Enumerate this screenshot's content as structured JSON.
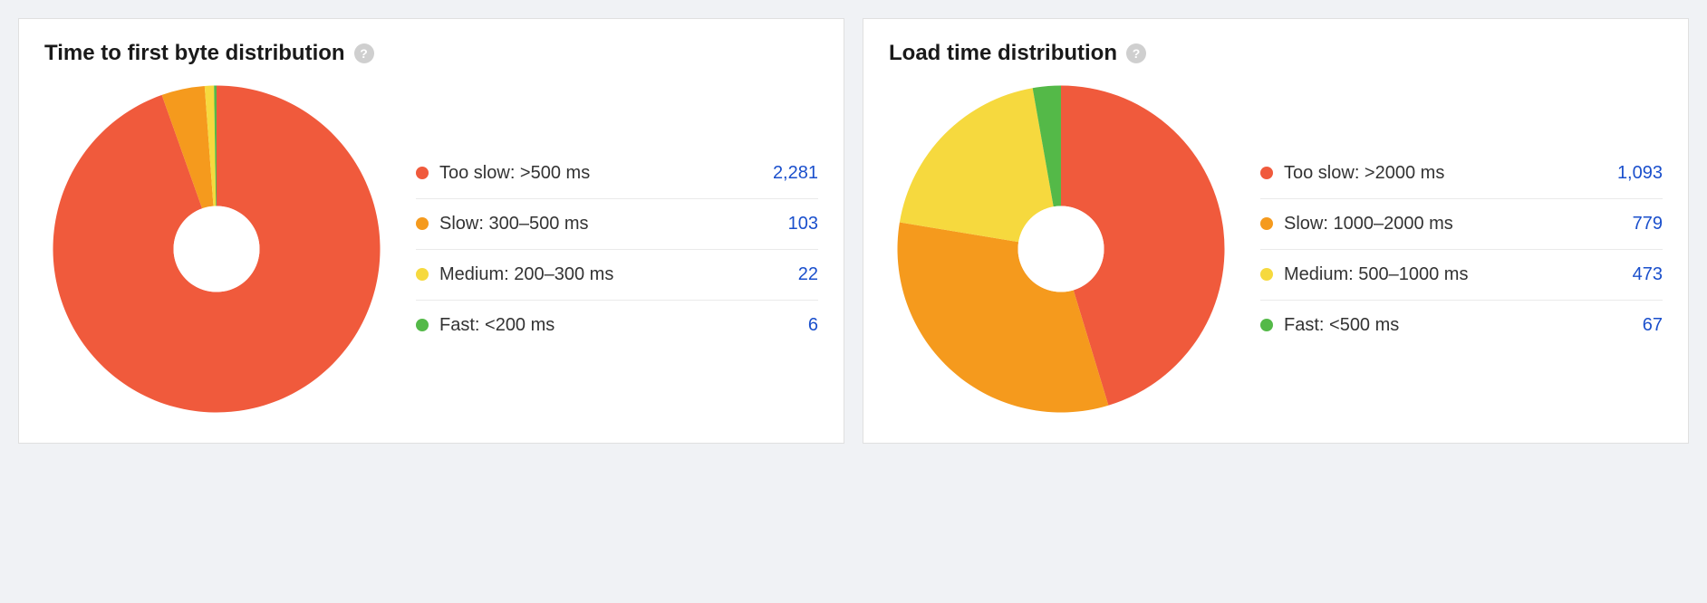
{
  "colors": {
    "too_slow": "#f05a3c",
    "slow": "#f59a1d",
    "medium": "#f6d93e",
    "fast": "#54b948"
  },
  "panels": [
    {
      "title": "Time to first byte distribution",
      "legend": [
        {
          "label": "Too slow: >500 ms",
          "value": "2,281",
          "color_key": "too_slow",
          "num": 2281
        },
        {
          "label": "Slow: 300–500 ms",
          "value": "103",
          "color_key": "slow",
          "num": 103
        },
        {
          "label": "Medium: 200–300 ms",
          "value": "22",
          "color_key": "medium",
          "num": 22
        },
        {
          "label": "Fast: <200 ms",
          "value": "6",
          "color_key": "fast",
          "num": 6
        }
      ]
    },
    {
      "title": "Load time distribution",
      "legend": [
        {
          "label": "Too slow: >2000 ms",
          "value": "1,093",
          "color_key": "too_slow",
          "num": 1093
        },
        {
          "label": "Slow: 1000–2000 ms",
          "value": "779",
          "color_key": "slow",
          "num": 779
        },
        {
          "label": "Medium: 500–1000 ms",
          "value": "473",
          "color_key": "medium",
          "num": 473
        },
        {
          "label": "Fast: <500 ms",
          "value": "67",
          "color_key": "fast",
          "num": 67
        }
      ]
    }
  ],
  "chart_data": [
    {
      "type": "pie",
      "title": "Time to first byte distribution",
      "categories": [
        "Too slow: >500 ms",
        "Slow: 300–500 ms",
        "Medium: 200–300 ms",
        "Fast: <200 ms"
      ],
      "values": [
        2281,
        103,
        22,
        6
      ],
      "colors": [
        "#f05a3c",
        "#f59a1d",
        "#f6d93e",
        "#54b948"
      ],
      "donut": true,
      "donut_hole_ratio": 0.25
    },
    {
      "type": "pie",
      "title": "Load time distribution",
      "categories": [
        "Too slow: >2000 ms",
        "Slow: 1000–2000 ms",
        "Medium: 500–1000 ms",
        "Fast: <500 ms"
      ],
      "values": [
        1093,
        779,
        473,
        67
      ],
      "colors": [
        "#f05a3c",
        "#f59a1d",
        "#f6d93e",
        "#54b948"
      ],
      "donut": true,
      "donut_hole_ratio": 0.25
    }
  ]
}
